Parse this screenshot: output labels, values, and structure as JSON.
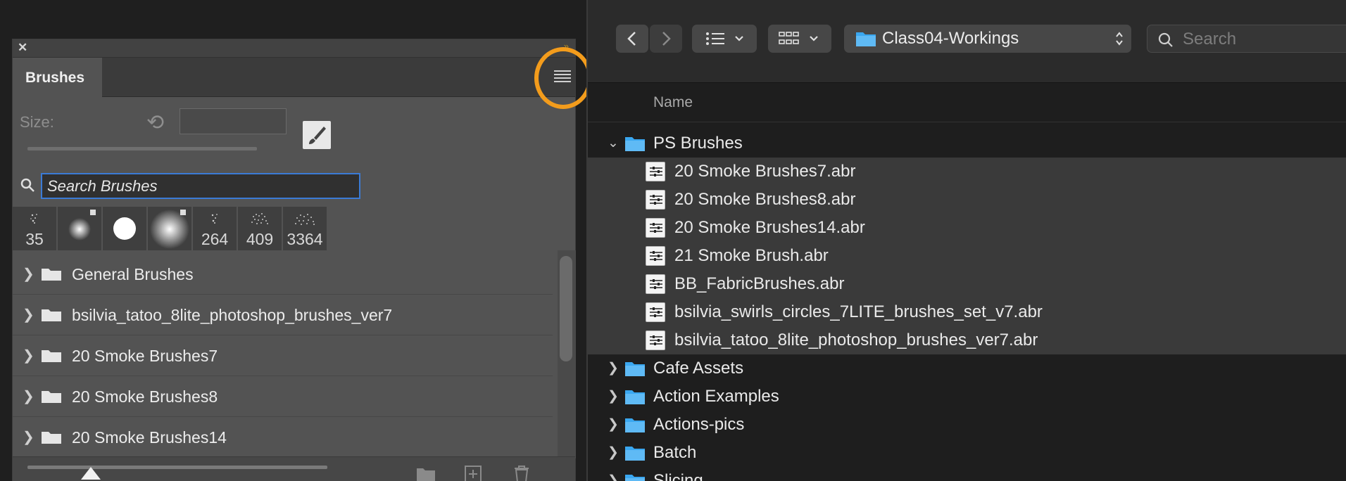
{
  "brushes_panel": {
    "tab_title": "Brushes",
    "size_label": "Size:",
    "size_value": "",
    "search_placeholder": "Search Brushes",
    "presets": [
      "35",
      "",
      "",
      "",
      "264",
      "409",
      "3364"
    ],
    "groups": [
      "General Brushes",
      "bsilvia_tatoo_8lite_photoshop_brushes_ver7",
      "20 Smoke Brushes7",
      "20 Smoke Brushes8",
      "20 Smoke Brushes14"
    ]
  },
  "finder": {
    "path_folder": "Class04-Workings",
    "search_placeholder": "Search",
    "column_name": "Name",
    "items": [
      {
        "name": "PS Brushes",
        "type": "folder",
        "expanded": true,
        "selected": false
      },
      {
        "name": "20 Smoke Brushes7.abr",
        "type": "abr",
        "selected": true
      },
      {
        "name": "20 Smoke Brushes8.abr",
        "type": "abr",
        "selected": true
      },
      {
        "name": "20 Smoke Brushes14.abr",
        "type": "abr",
        "selected": true
      },
      {
        "name": "21 Smoke Brush.abr",
        "type": "abr",
        "selected": true
      },
      {
        "name": "BB_FabricBrushes.abr",
        "type": "abr",
        "selected": true
      },
      {
        "name": "bsilvia_swirls_circles_7LITE_brushes_set_v7.abr",
        "type": "abr",
        "selected": true
      },
      {
        "name": "bsilvia_tatoo_8lite_photoshop_brushes_ver7.abr",
        "type": "abr",
        "selected": true
      },
      {
        "name": "Cafe Assets",
        "type": "folder",
        "expanded": false,
        "selected": false
      },
      {
        "name": "Action Examples",
        "type": "folder",
        "expanded": false,
        "selected": false
      },
      {
        "name": "Actions-pics",
        "type": "folder",
        "expanded": false,
        "selected": false
      },
      {
        "name": "Batch",
        "type": "folder",
        "expanded": false,
        "selected": false
      },
      {
        "name": "Slicing",
        "type": "folder",
        "expanded": false,
        "selected": false
      }
    ]
  },
  "colors": {
    "highlight_ring": "#f39c1c",
    "folder_blue": "#3aa7f0",
    "search_focus": "#3b7bd6"
  }
}
